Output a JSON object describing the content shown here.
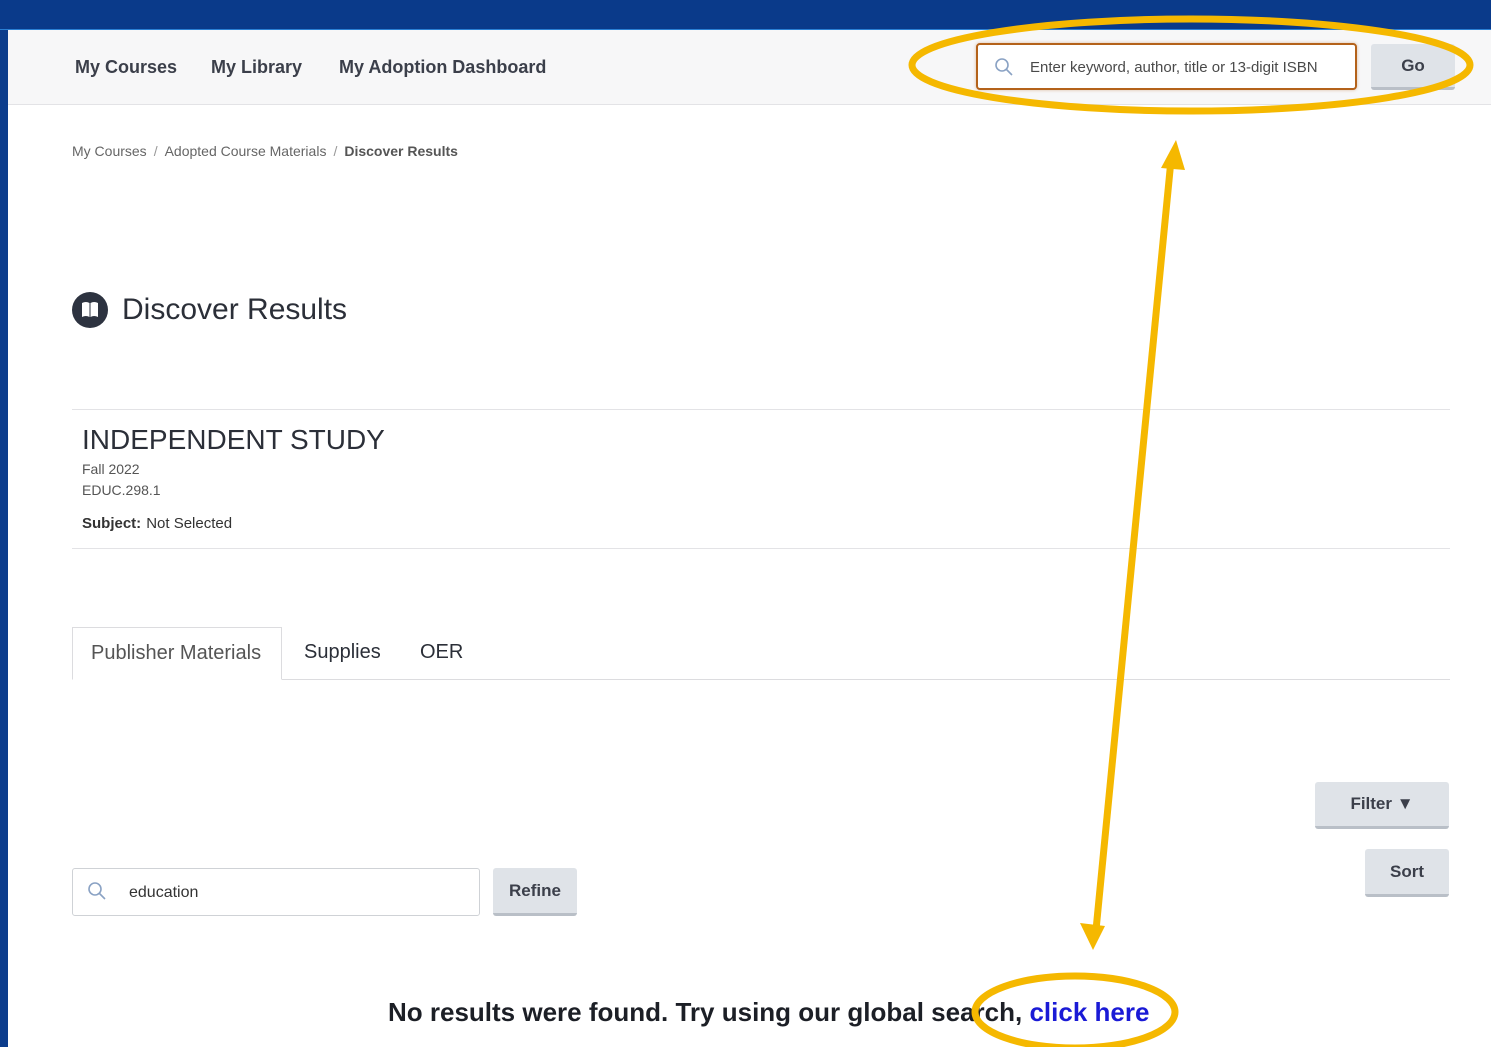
{
  "nav": {
    "links": [
      "My Courses",
      "My Library",
      "My Adoption Dashboard"
    ],
    "search_placeholder": "Enter keyword, author, title or 13-digit ISBN",
    "go_label": "Go"
  },
  "breadcrumb": {
    "items": [
      "My Courses",
      "Adopted Course Materials"
    ],
    "current": "Discover Results",
    "separator": "/"
  },
  "page": {
    "title": "Discover Results",
    "icon": "book-icon"
  },
  "course": {
    "name": "INDEPENDENT STUDY",
    "term": "Fall 2022",
    "code": "EDUC.298.1",
    "subject_label": "Subject:",
    "subject_value": "Not Selected"
  },
  "tabs": [
    "Publisher Materials",
    "Supplies",
    "OER"
  ],
  "controls": {
    "filter_label": "Filter ▼",
    "sort_label": "Sort",
    "refine_value": "education",
    "refine_label": "Refine"
  },
  "message": {
    "text": "No results were found. Try using our global search, ",
    "link": "click here"
  },
  "colors": {
    "annotation": "#f5b800",
    "frame_background": "#0c3d8c",
    "link": "#1a1ad6"
  }
}
